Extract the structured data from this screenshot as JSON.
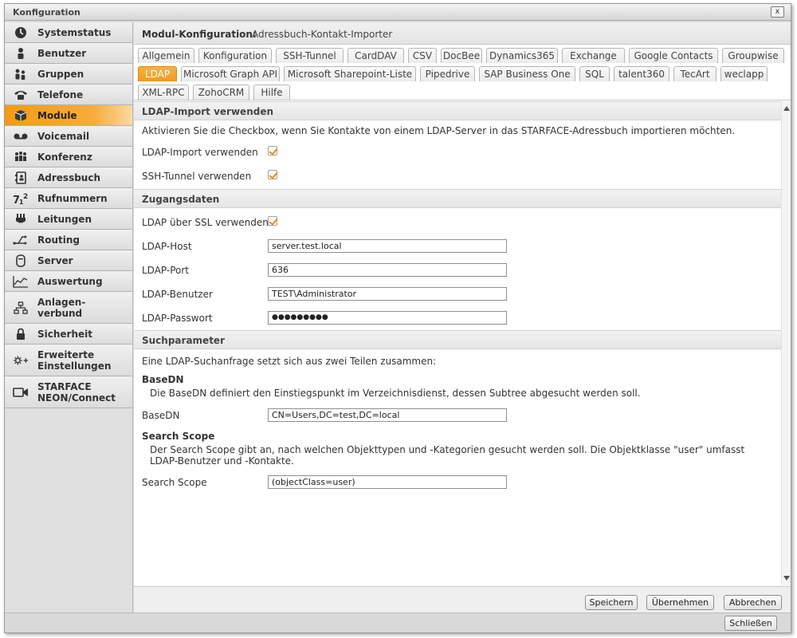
{
  "window": {
    "title": "Konfiguration",
    "close_label": "x"
  },
  "colors": {
    "accent": "#f39a14",
    "check": "#e88a10"
  },
  "sidebar": {
    "items": [
      {
        "label": "Systemstatus",
        "icon": "clock-icon",
        "active": false
      },
      {
        "label": "Benutzer",
        "icon": "user-icon",
        "active": false
      },
      {
        "label": "Gruppen",
        "icon": "group-icon",
        "active": false
      },
      {
        "label": "Telefone",
        "icon": "phone-icon",
        "active": false
      },
      {
        "label": "Module",
        "icon": "module-box-icon",
        "active": true
      },
      {
        "label": "Voicemail",
        "icon": "voicemail-icon",
        "active": false
      },
      {
        "label": "Konferenz",
        "icon": "conference-icon",
        "active": false
      },
      {
        "label": "Adressbuch",
        "icon": "addressbook-icon",
        "active": false
      },
      {
        "label": "Rufnummern",
        "icon": "numbers-icon",
        "active": false
      },
      {
        "label": "Leitungen",
        "icon": "plug-icon",
        "active": false
      },
      {
        "label": "Routing",
        "icon": "routing-icon",
        "active": false
      },
      {
        "label": "Server",
        "icon": "server-icon",
        "active": false
      },
      {
        "label": "Auswertung",
        "icon": "chart-icon",
        "active": false
      },
      {
        "label": "Anlagen-\nverbund",
        "icon": "network-icon",
        "active": false
      },
      {
        "label": "Sicherheit",
        "icon": "lock-icon",
        "active": false
      },
      {
        "label": "Erweiterte\nEinstellungen",
        "icon": "advanced-settings-icon",
        "active": false
      },
      {
        "label": "STARFACE\nNEON/Connect",
        "icon": "video-camera-icon",
        "active": false
      }
    ]
  },
  "header": {
    "label": "Modul-Konfiguration:",
    "value": "Adressbuch-Kontakt-Importer"
  },
  "tabs": {
    "row1": [
      "Allgemein",
      "Konfiguration",
      "SSH-Tunnel",
      "CardDAV",
      "CSV",
      "DocBee",
      "Dynamics365",
      "Exchange",
      "Google Contacts",
      "Groupwise"
    ],
    "row2": [
      "LDAP",
      "Microsoft Graph API",
      "Microsoft Sharepoint-Liste",
      "Pipedrive",
      "SAP Business One",
      "SQL",
      "talent360",
      "TecArt",
      "weclapp"
    ],
    "row3": [
      "XML-RPC",
      "ZohoCRM",
      "Hilfe"
    ],
    "active": "LDAP"
  },
  "ldap_import": {
    "section_title": "LDAP-Import verwenden",
    "description": "Aktivieren Sie die Checkbox, wenn Sie Kontakte von einem LDAP-Server in das STARFACE-Adressbuch importieren möchten.",
    "use_ldap_label": "LDAP-Import verwenden",
    "use_ldap_checked": true,
    "use_ssh_label": "SSH-Tunnel verwenden",
    "use_ssh_checked": true
  },
  "credentials": {
    "section_title": "Zugangsdaten",
    "ssl_label": "LDAP über SSL verwenden",
    "ssl_checked": true,
    "host_label": "LDAP-Host",
    "host_value": "server.test.local",
    "port_label": "LDAP-Port",
    "port_value": "636",
    "user_label": "LDAP-Benutzer",
    "user_value": "TEST\\Administrator",
    "password_label": "LDAP-Passwort",
    "password_value": "●●●●●●●●●"
  },
  "search": {
    "section_title": "Suchparameter",
    "intro": "Eine LDAP-Suchanfrage setzt sich aus zwei Teilen zusammen:",
    "basedn_heading": "BaseDN",
    "basedn_desc": "Die BaseDN definiert den Einstiegspunkt im Verzeichnisdienst, dessen Subtree abgesucht werden soll.",
    "basedn_label": "BaseDN",
    "basedn_value": "CN=Users,DC=test,DC=local",
    "scope_heading": "Search Scope",
    "scope_desc": "Der Search Scope gibt an, nach welchen Objekttypen und -Kategorien gesucht werden soll. Die Objektklasse \"user\" umfasst LDAP-Benutzer und -Kontakte.",
    "scope_label": "Search Scope",
    "scope_value": "(objectClass=user)"
  },
  "footer": {
    "save": "Speichern",
    "apply": "Übernehmen",
    "cancel": "Abbrechen"
  },
  "bottom": {
    "close": "Schließen"
  }
}
